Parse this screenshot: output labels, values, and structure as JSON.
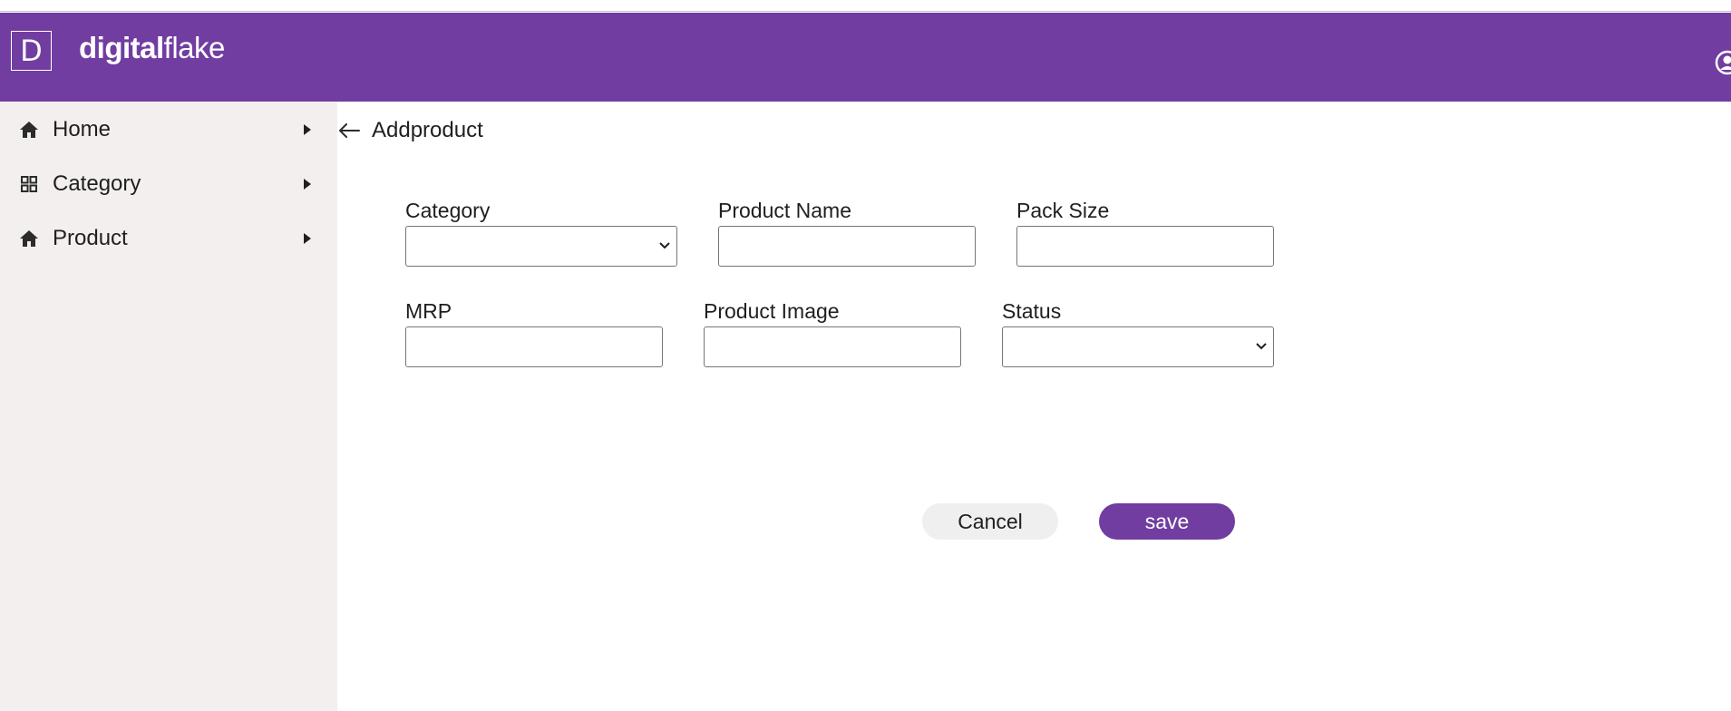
{
  "header": {
    "logo_letter": "D",
    "brand_bold": "digital",
    "brand_light": "flake"
  },
  "sidebar": {
    "items": [
      {
        "label": "Home",
        "icon": "home-icon"
      },
      {
        "label": "Category",
        "icon": "grid-icon"
      },
      {
        "label": "Product",
        "icon": "home-icon"
      }
    ]
  },
  "page": {
    "title": "Addproduct"
  },
  "form": {
    "category_label": "Category",
    "category_value": "",
    "product_name_label": "Product Name",
    "product_name_value": "",
    "pack_size_label": "Pack Size",
    "pack_size_value": "",
    "mrp_label": "MRP",
    "mrp_value": "",
    "product_image_label": "Product Image",
    "product_image_value": "",
    "status_label": "Status",
    "status_value": ""
  },
  "actions": {
    "cancel_label": "Cancel",
    "save_label": "save"
  },
  "colors": {
    "brand": "#713da1",
    "sidebar_bg": "#f4efef",
    "cancel_bg": "#efefef"
  }
}
